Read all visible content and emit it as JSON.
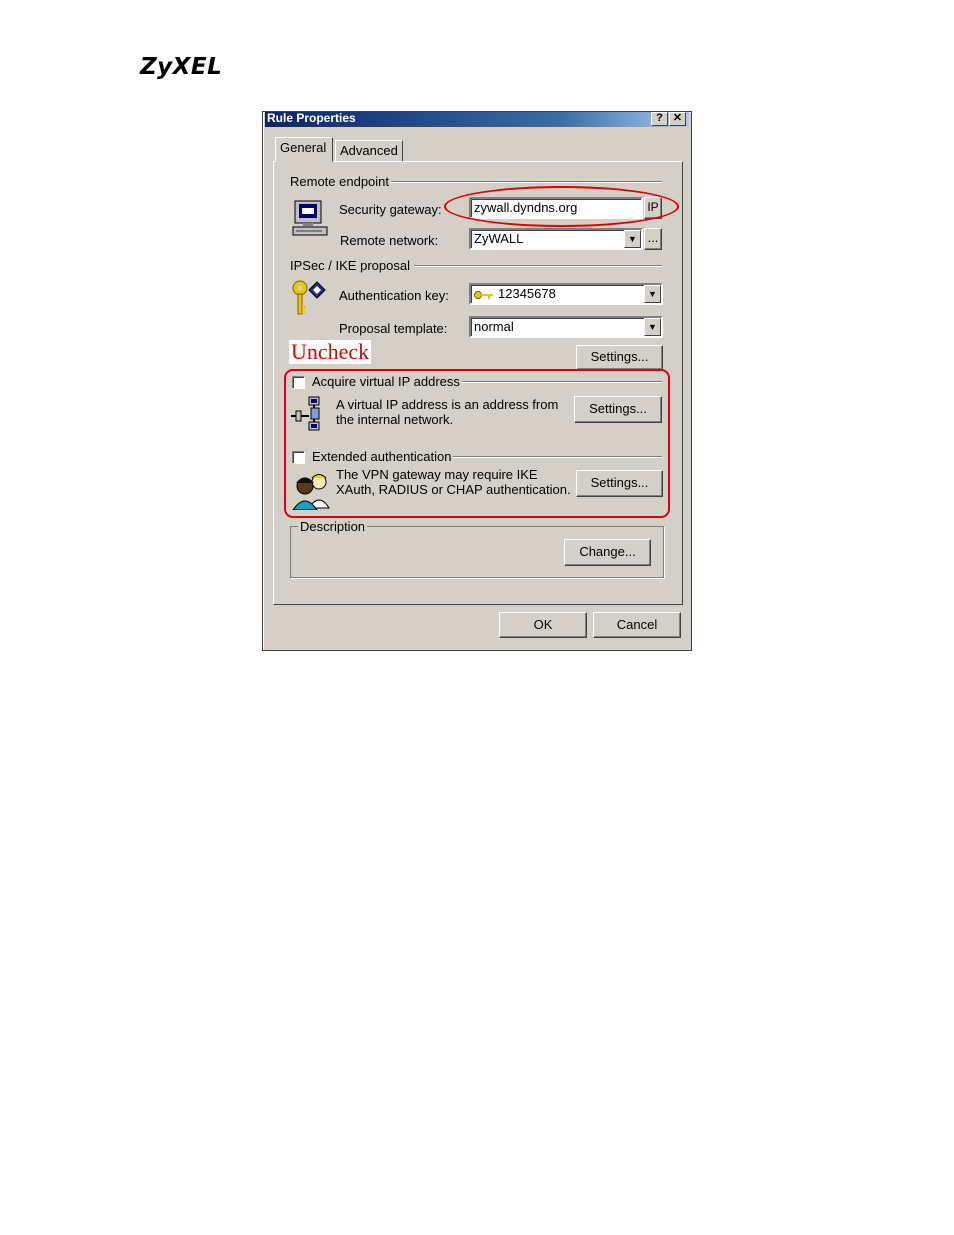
{
  "logo": {
    "text": "ZyXEL"
  },
  "window": {
    "title": "Rule Properties",
    "help_button": "?",
    "close_button": "✕"
  },
  "tabs": [
    {
      "label": "General",
      "active": true
    },
    {
      "label": "Advanced",
      "active": false
    }
  ],
  "remote_endpoint": {
    "group_label": "Remote endpoint",
    "security_gateway_label": "Security gateway:",
    "security_gateway_value": "zywall.dyndns.org",
    "ip_button": "IP",
    "remote_network_label": "Remote network:",
    "remote_network_value": "ZyWALL",
    "browse_button": "..."
  },
  "ipsec": {
    "group_label": "IPSec / IKE proposal",
    "auth_key_label": "Authentication key:",
    "auth_key_value": "12345678",
    "proposal_label": "Proposal template:",
    "proposal_value": "normal",
    "settings_button": "Settings..."
  },
  "annotation": {
    "uncheck_text": "Uncheck",
    "color": "#e00000"
  },
  "virtual_ip": {
    "checkbox_label": "Acquire virtual IP address",
    "checked": false,
    "description_line1": "A virtual IP address is an address from",
    "description_line2": "the internal network.",
    "settings_button": "Settings..."
  },
  "extended_auth": {
    "checkbox_label": "Extended authentication",
    "checked": false,
    "description_line1": "The VPN gateway may require IKE",
    "description_line2": "XAuth, RADIUS or CHAP authentication.",
    "settings_button": "Settings..."
  },
  "description": {
    "group_label": "Description",
    "change_button": "Change..."
  },
  "footer": {
    "ok_button": "OK",
    "cancel_button": "Cancel"
  },
  "colors": {
    "dialog_bg": "#d4d0c8",
    "titlebar": "#0a246a",
    "annotation": "#e00000"
  },
  "icons": [
    "computer-icon",
    "keys-icon",
    "network-adapter-icon",
    "users-icon",
    "key-icon"
  ]
}
